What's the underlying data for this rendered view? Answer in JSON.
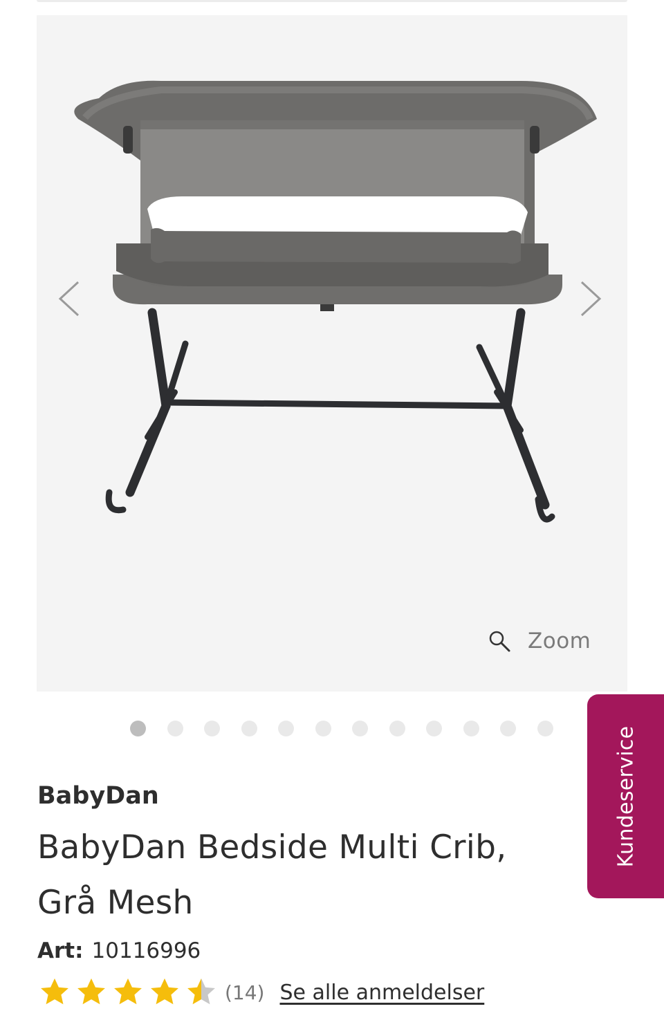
{
  "gallery": {
    "zoom_label": "Zoom",
    "image_count": 12,
    "active_index": 0,
    "image_subject": "bedside-crib-grey-mesh"
  },
  "support": {
    "label": "Kundeservice",
    "color": "#a3175b"
  },
  "product": {
    "brand": "BabyDan",
    "title_line1": "BabyDan Bedside Multi Crib,",
    "title_line2": "Grå Mesh",
    "art_label": "Art:",
    "art_number": "10116996",
    "rating": 4.5,
    "rating_max": 5,
    "review_count": "(14)",
    "reviews_link": "Se alle anmeldelser",
    "star_color": "#f5bd0c",
    "star_empty_color": "#c8c8c8"
  }
}
